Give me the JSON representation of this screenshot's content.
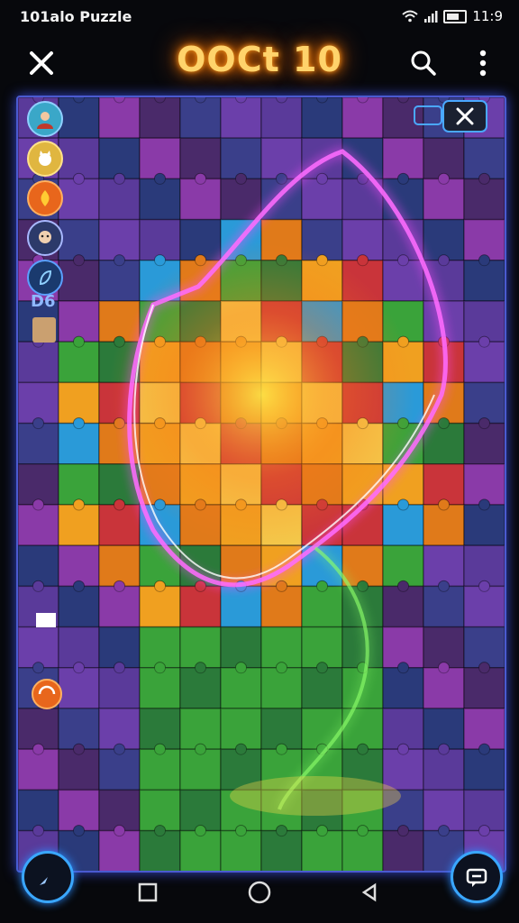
{
  "status_bar": {
    "app_name": "101alo Puzzle",
    "time": "11:9"
  },
  "header": {
    "title": "OOCt 10"
  },
  "sidebar": {
    "avatars": [
      {
        "name": "avatar-player-icon",
        "color": "#3aa7c8"
      },
      {
        "name": "avatar-cat-icon",
        "color": "#e0b640"
      },
      {
        "name": "avatar-fire-icon",
        "color": "#e8661c"
      },
      {
        "name": "avatar-person-icon",
        "color": "#2c3a6a"
      },
      {
        "name": "avatar-leaf-icon",
        "color": "#1a3a6e"
      }
    ],
    "badge_text": "D6"
  },
  "colors": {
    "accent": "#ff8a1f",
    "frame": "#4a5ad0",
    "fab_ring": "#3aa7ff"
  }
}
